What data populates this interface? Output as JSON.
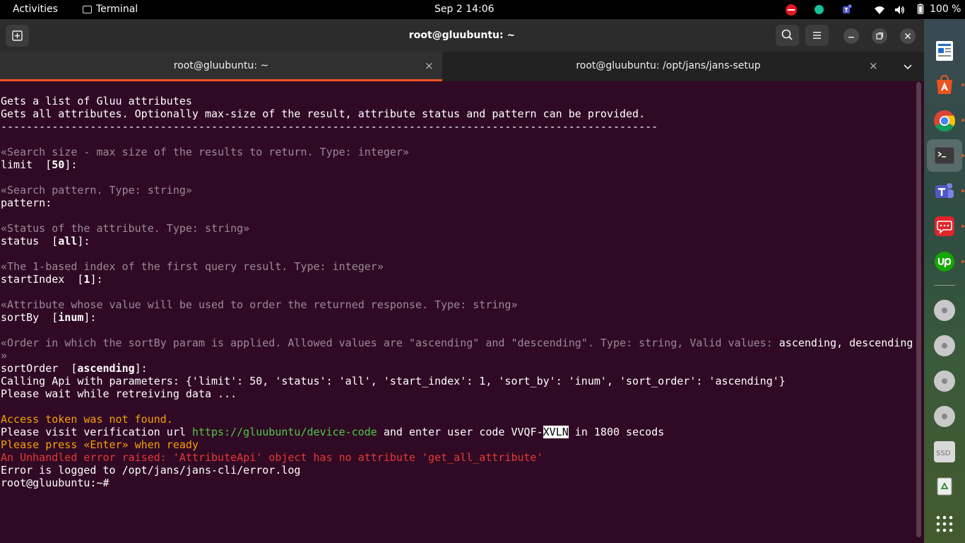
{
  "topbar": {
    "activities": "Activities",
    "app_menu": "Terminal",
    "clock": "Sep 2  14:06",
    "battery": "100 %"
  },
  "window": {
    "title": "root@gluubuntu: ~",
    "tabs": [
      {
        "label": "root@gluubuntu: ~",
        "active": true
      },
      {
        "label": "root@gluubuntu: /opt/jans/jans-setup",
        "active": false
      }
    ],
    "close_glyph": "×"
  },
  "terminal": {
    "l1": "Gets a list of Gluu attributes",
    "l2": "Gets all attributes. Optionally max-size of the result, attribute status and pattern can be provided.",
    "l3": "-------------------------------------------------------------------------------------------------------",
    "l5": "«Search size - max size of the results to return. Type: integer»",
    "l6a": "limit  [",
    "l6b": "50",
    "l6c": "]:",
    "l8": "«Search pattern. Type: string»",
    "l9": "pattern:",
    "l11": "«Status of the attribute. Type: string»",
    "l12a": "status  [",
    "l12b": "all",
    "l12c": "]:",
    "l14": "«The 1-based index of the first query result. Type: integer»",
    "l15a": "startIndex  [",
    "l15b": "1",
    "l15c": "]:",
    "l17": "«Attribute whose value will be used to order the returned response. Type: string»",
    "l18a": "sortBy  [",
    "l18b": "inum",
    "l18c": "]:",
    "l20a": "«Order in which the sortBy param is applied. Allowed values are \"ascending\" and \"descending\". Type: string, Valid values: ",
    "l20b": "ascending, descending",
    "l21": "»",
    "l22a": "sortOrder  [",
    "l22b": "ascending",
    "l22c": "]:",
    "l23": "Calling Api with parameters: {'limit': 50, 'status': 'all', 'start_index': 1, 'sort_by': 'inum', 'sort_order': 'ascending'}",
    "l24": "Please wait while retreiving data ...",
    "l26": "Access token was not found.",
    "l27a": "Please visit verification url ",
    "l27b": "https://gluubuntu/device-code",
    "l27c": " and enter user code VVQF-",
    "l27d": "XVLN",
    "l27e": " in 1800 secods",
    "l28": "Please press «Enter» when ready",
    "l29": "An Unhandled error raised: 'AttributeApi' object has no attribute 'get_all_attribute'",
    "l30": "Error is logged to /opt/jans/jans-cli/error.log",
    "l31": "root@gluubuntu:~#"
  },
  "dock": {
    "items": [
      "text-editor-icon",
      "app-store-icon",
      "chrome-icon",
      "terminal-icon",
      "teams-icon",
      "chat-icon",
      "upwork-icon",
      "drive-icon",
      "drive-icon",
      "drive-icon",
      "drive-icon",
      "ssd-icon",
      "trash-icon"
    ],
    "ssd_label": "SSD"
  },
  "colors": {
    "terminal_bg": "#300a24",
    "accent": "#e95420",
    "warning": "#f6a00a",
    "error": "#e53935",
    "link": "#4ec94a"
  }
}
